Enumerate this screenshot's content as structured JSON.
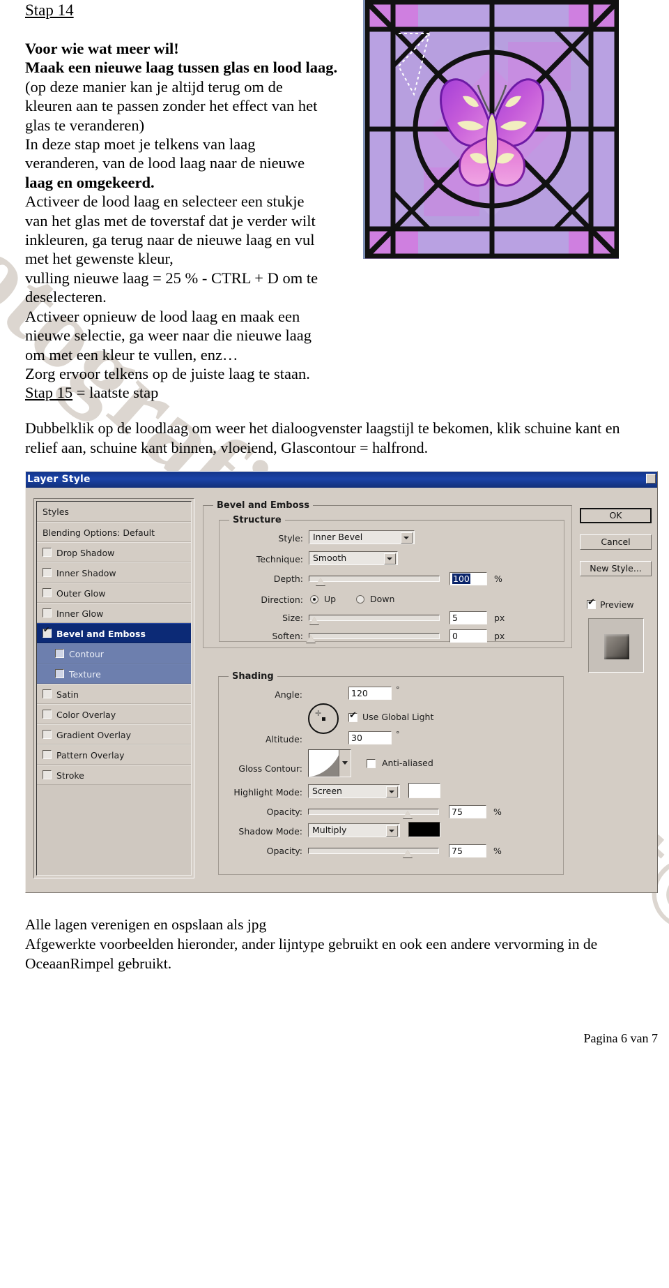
{
  "document": {
    "step_heading": "Stap 14",
    "body_lines": [
      {
        "text": "Voor wie wat meer wil!",
        "bold": true
      },
      {
        "text": "Maak een nieuwe laag tussen glas en lood laag.",
        "bold": true
      },
      {
        "text": "(op deze manier kan je altijd terug om de",
        "bold": false
      },
      {
        "text": "kleuren aan te passen zonder het effect van het",
        "bold": false
      },
      {
        "text": "glas te veranderen)",
        "bold": false
      },
      {
        "text": "In deze stap moet je telkens van laag",
        "bold": false
      },
      {
        "text": "veranderen, van de lood laag naar de nieuwe",
        "bold": false
      },
      {
        "text": "laag en omgekeerd.",
        "bold": true
      },
      {
        "text": "Activeer de lood laag en selecteer een stukje",
        "bold": false
      },
      {
        "text": "van het glas met de toverstaf dat je verder wilt",
        "bold": false
      },
      {
        "text": "inkleuren, ga terug naar de nieuwe laag en vul",
        "bold": false
      },
      {
        "text": "met het gewenste kleur,",
        "bold": false
      },
      {
        "text": "vulling nieuwe laag = 25 % - CTRL + D om te",
        "bold": false
      },
      {
        "text": "deselecteren.",
        "bold": false
      },
      {
        "text": "Activeer opnieuw de lood laag en maak een",
        "bold": false
      },
      {
        "text": "nieuwe selectie, ga weer naar die nieuwe laag",
        "bold": false
      },
      {
        "text": "om met een kleur te vullen, enz…",
        "bold": false
      },
      {
        "text": "Zorg ervoor telkens op de juiste laag te staan.",
        "bold": false
      }
    ],
    "step15_heading_underlined": "Stap 15",
    "step15_rest": " = laatste stap",
    "paragraph_mid_line1": "Dubbelklik op de loodlaag om weer het dialoogvenster laagstijl te bekomen, klik schuine kant en",
    "paragraph_mid_line2": "relief aan, schuine kant binnen, vloeiend, Glascontour = halfrond.",
    "paragraph_bottom_line1": "Alle lagen verenigen en ospslaan als jpg",
    "paragraph_bottom_line2": "Afgewerkte voorbeelden hieronder, ander lijntype gebruikt en ook een andere vervorming in de",
    "paragraph_bottom_line3": "OceaanRimpel gebruikt.",
    "page_footer": "Pagina 6 van 7",
    "watermark": "Fotografie Copyright©Photoshop"
  },
  "glass_image": {
    "alt_name": "stained-glass-butterfly-preview",
    "background_color": "#b79fdf",
    "lead_color": "#111111",
    "accent_color": "#cf7fe0",
    "butterfly_colors": [
      "#8b2fd0",
      "#e06ad2",
      "#f2eec0",
      "#c24fd6"
    ]
  },
  "dialog": {
    "title": "Layer Style",
    "styles_panel": {
      "header_label": "Styles",
      "blending_label": "Blending Options: Default",
      "items": [
        {
          "label": "Drop Shadow",
          "checked": false,
          "selected": false,
          "sub": false
        },
        {
          "label": "Inner Shadow",
          "checked": false,
          "selected": false,
          "sub": false
        },
        {
          "label": "Outer Glow",
          "checked": false,
          "selected": false,
          "sub": false
        },
        {
          "label": "Inner Glow",
          "checked": false,
          "selected": false,
          "sub": false
        },
        {
          "label": "Bevel and Emboss",
          "checked": true,
          "selected": true,
          "sub": false
        },
        {
          "label": "Contour",
          "checked": false,
          "selected": false,
          "sub": true
        },
        {
          "label": "Texture",
          "checked": false,
          "selected": false,
          "sub": true
        },
        {
          "label": "Satin",
          "checked": false,
          "selected": false,
          "sub": false
        },
        {
          "label": "Color Overlay",
          "checked": false,
          "selected": false,
          "sub": false
        },
        {
          "label": "Gradient Overlay",
          "checked": false,
          "selected": false,
          "sub": false
        },
        {
          "label": "Pattern Overlay",
          "checked": false,
          "selected": false,
          "sub": false
        },
        {
          "label": "Stroke",
          "checked": false,
          "selected": false,
          "sub": false
        }
      ]
    },
    "bevel": {
      "group_title": "Bevel and Emboss",
      "structure_title": "Structure",
      "style_label": "Style:",
      "style_value": "Inner Bevel",
      "technique_label": "Technique:",
      "technique_value": "Smooth",
      "depth_label": "Depth:",
      "depth_value": "100",
      "depth_unit": "%",
      "direction_label": "Direction:",
      "direction_up": "Up",
      "direction_down": "Down",
      "direction_selected": "Up",
      "size_label": "Size:",
      "size_value": "5",
      "size_unit": "px",
      "soften_label": "Soften:",
      "soften_value": "0",
      "soften_unit": "px"
    },
    "shading": {
      "group_title": "Shading",
      "angle_label": "Angle:",
      "angle_value": "120",
      "angle_unit": "°",
      "use_global_light_label": "Use Global Light",
      "use_global_light_checked": true,
      "altitude_label": "Altitude:",
      "altitude_value": "30",
      "altitude_unit": "°",
      "gloss_contour_label": "Gloss Contour:",
      "anti_aliased_label": "Anti-aliased",
      "anti_aliased_checked": false,
      "highlight_mode_label": "Highlight Mode:",
      "highlight_mode_value": "Screen",
      "highlight_color": "#ffffff",
      "highlight_opacity_label": "Opacity:",
      "highlight_opacity_value": "75",
      "highlight_opacity_unit": "%",
      "shadow_mode_label": "Shadow Mode:",
      "shadow_mode_value": "Multiply",
      "shadow_color": "#000000",
      "shadow_opacity_label": "Opacity:",
      "shadow_opacity_value": "75",
      "shadow_opacity_unit": "%"
    },
    "buttons": {
      "ok": "OK",
      "cancel": "Cancel",
      "new_style": "New Style...",
      "preview_label": "Preview",
      "preview_checked": true
    }
  }
}
